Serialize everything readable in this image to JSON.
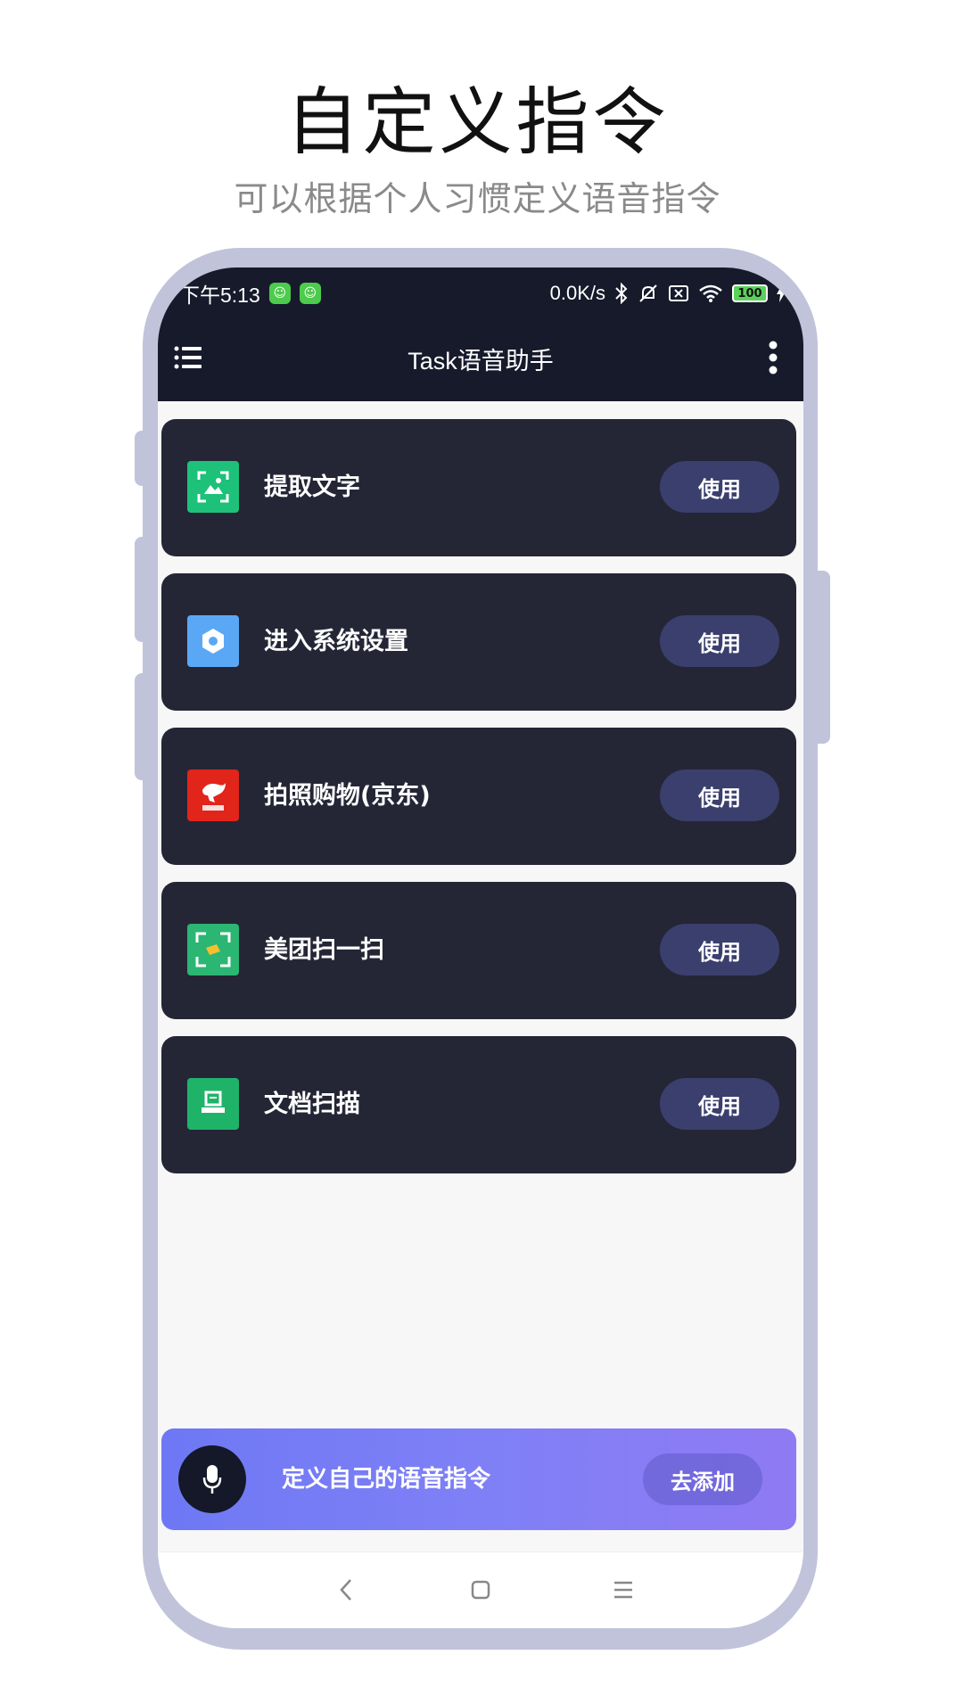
{
  "promo_header": {
    "title": "自定义指令",
    "subtitle": "可以根据个人习惯定义语音指令"
  },
  "status_bar": {
    "time": "下午5:13",
    "speed": "0.0K/s",
    "battery": "100"
  },
  "app_bar": {
    "title": "Task语音助手",
    "menu_icon": "hamburger-icon",
    "more_icon": "more-vertical-icon"
  },
  "commands": [
    {
      "label": "提取文字",
      "button": "使用",
      "icon": "text-scan-icon",
      "icon_color": "#1dc17a"
    },
    {
      "label": "进入系统设置",
      "button": "使用",
      "icon": "settings-icon",
      "icon_color": "#5aa8f5"
    },
    {
      "label": "拍照购物(京东)",
      "button": "使用",
      "icon": "jd-icon",
      "icon_color": "#e1251b"
    },
    {
      "label": "美团扫一扫",
      "button": "使用",
      "icon": "meituan-scan-icon",
      "icon_color": "#2bb673"
    },
    {
      "label": "文档扫描",
      "button": "使用",
      "icon": "document-scan-icon",
      "icon_color": "#1fb36a"
    }
  ],
  "bottom_banner": {
    "text": "定义自己的语音指令",
    "button": "去添加",
    "icon": "microphone-icon"
  },
  "colors": {
    "app_bar_bg": "#161a2b",
    "card_bg": "#242636",
    "button_bg": "#3b3f6d",
    "frame": "#c0c3da"
  }
}
